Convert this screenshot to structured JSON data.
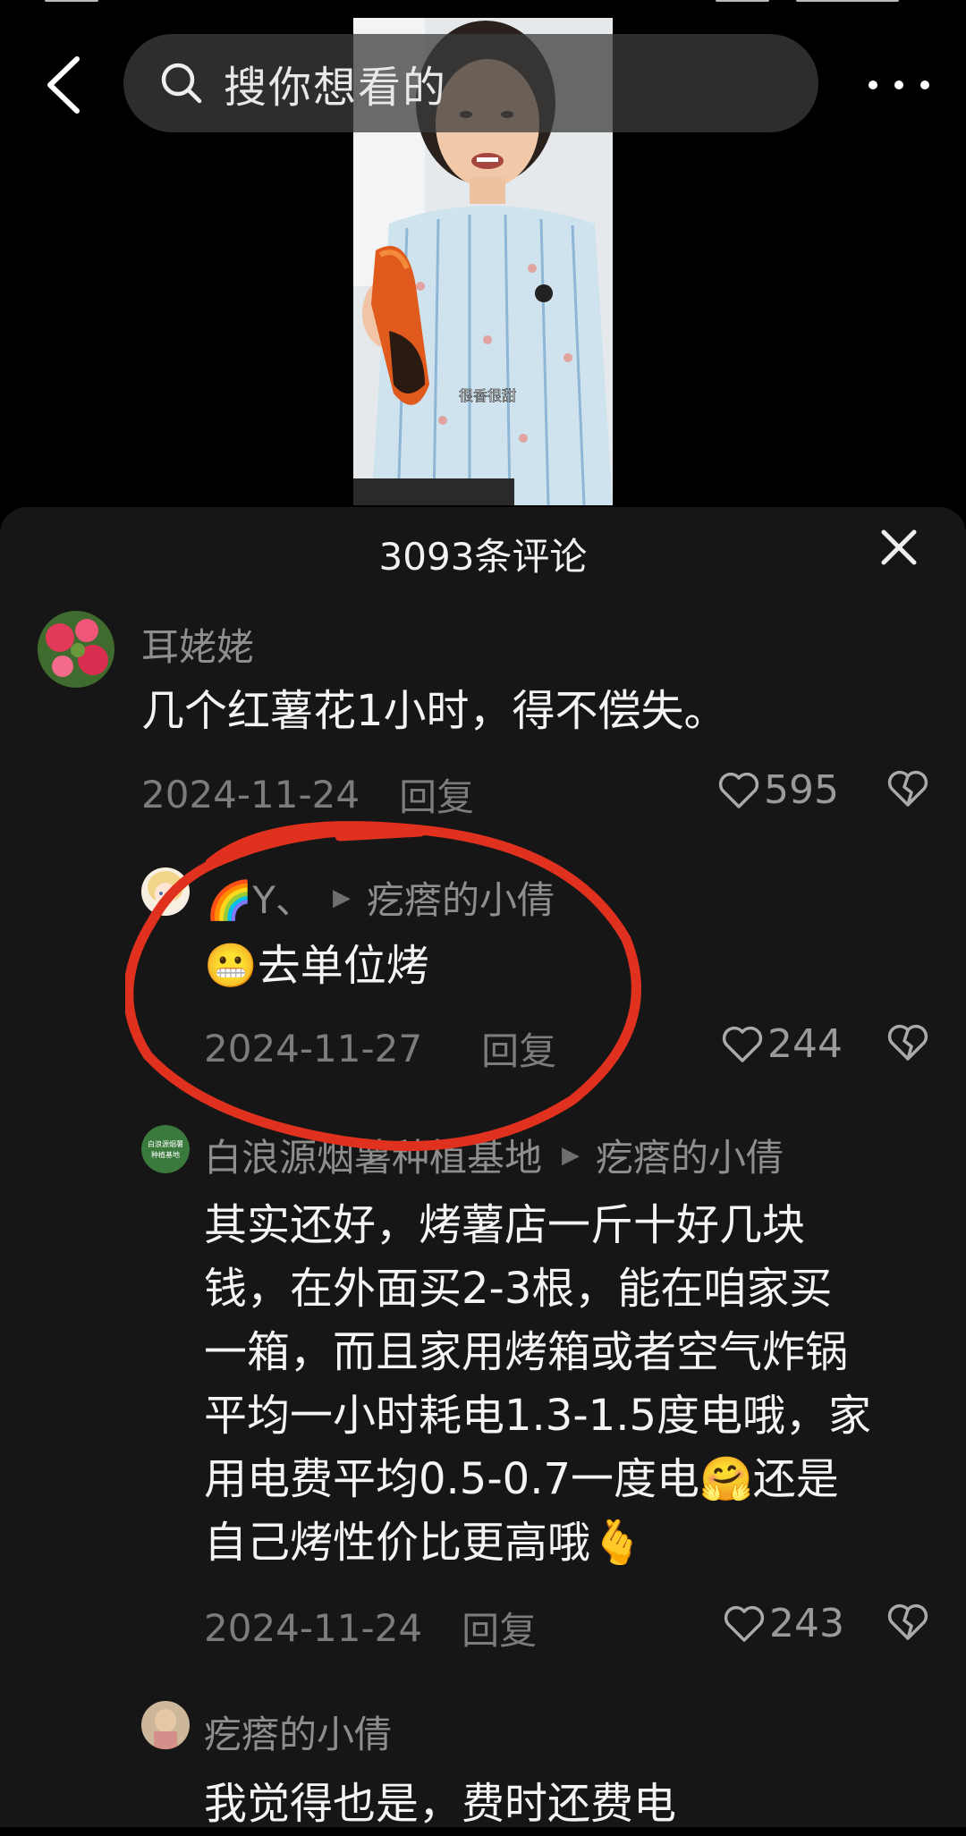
{
  "header": {
    "search_placeholder": "搜你想看的",
    "icons": [
      "back-arrow-icon",
      "search-icon",
      "more-icon"
    ]
  },
  "video": {
    "subtitle": "很香很甜"
  },
  "comments_panel": {
    "count_label": "3093条评论",
    "close_icon": "close-icon",
    "comments": [
      {
        "user": "耳姥姥",
        "text": "几个红薯花1小时，得不偿失。",
        "date": "2024-11-24",
        "reply": "回复",
        "likes": "595"
      },
      {
        "user": "🌈Y、",
        "reply_to": "疙瘩的小倩",
        "text": "去单位烤",
        "emoji": "😬",
        "date": "2024-11-27",
        "reply": "回复",
        "likes": "244"
      },
      {
        "user": "白浪源烟薯种植基地",
        "reply_to": "疙瘩的小倩",
        "avatar_text": "白浪源烟薯种植基地",
        "lines": [
          "其实还好，烤薯店一斤十好几块",
          "钱，在外面买2-3根，能在咱家买",
          "一箱，而且家用烤箱或者空气炸锅",
          "平均一小时耗电1.3-1.5度电哦，家",
          "用电费平均0.5-0.7一度电🤗还是",
          "自己烤性价比更高哦🫰"
        ],
        "date": "2024-11-24",
        "reply": "回复",
        "likes": "243"
      },
      {
        "user": "疙瘩的小倩",
        "text": "我觉得也是，费时还费电"
      }
    ]
  },
  "colors": {
    "background": "#000000",
    "sheet": "#161616",
    "annotation_red": "#e0301e",
    "username": "#8e8e8e",
    "text": "#f4f4f4"
  }
}
